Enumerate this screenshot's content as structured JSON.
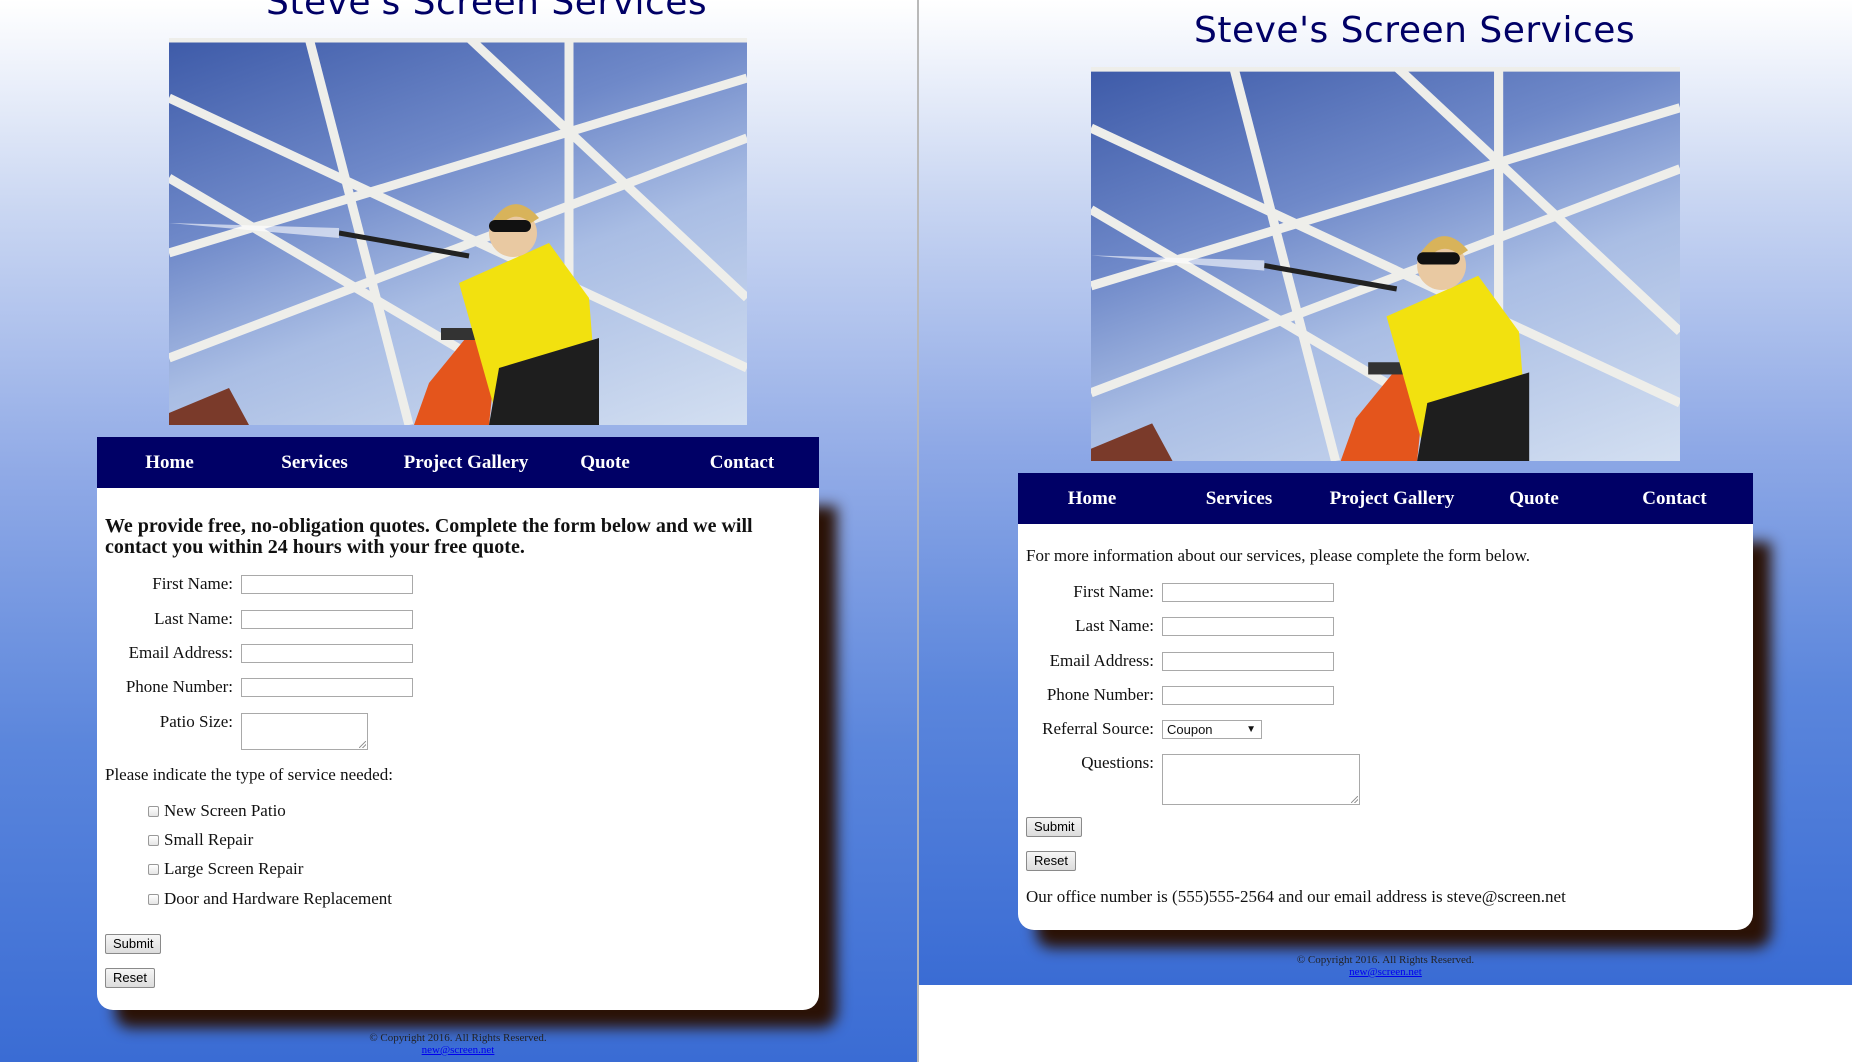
{
  "site_title": "Steve's Screen Services",
  "nav": {
    "items": [
      "Home",
      "Services",
      "Project Gallery",
      "Quote",
      "Contact"
    ]
  },
  "hero": {
    "alt": "Woman in yellow shirt pressure washing a patio screen enclosure from an orange ladder"
  },
  "quote_page": {
    "heading": "We provide free, no-obligation quotes. Complete the form below and we will contact you within 24 hours with your free quote.",
    "fields": [
      {
        "label": "First Name:",
        "value": ""
      },
      {
        "label": "Last Name:",
        "value": ""
      },
      {
        "label": "Email Address:",
        "value": ""
      },
      {
        "label": "Phone Number:",
        "value": ""
      }
    ],
    "patio_label": "Patio Size:",
    "service_prompt": "Please indicate the type of service needed:",
    "services": [
      "New Screen Patio",
      "Small Repair",
      "Large Screen Repair",
      "Door and Hardware Replacement"
    ],
    "submit": "Submit",
    "reset": "Reset"
  },
  "contact_page": {
    "intro": "For more information about our services, please complete the form below.",
    "fields": [
      {
        "label": "First Name:",
        "value": ""
      },
      {
        "label": "Last Name:",
        "value": ""
      },
      {
        "label": "Email Address:",
        "value": ""
      },
      {
        "label": "Phone Number:",
        "value": ""
      }
    ],
    "referral_label": "Referral Source:",
    "referral_selected": "Coupon",
    "questions_label": "Questions:",
    "submit": "Submit",
    "reset": "Reset",
    "office_line": "Our office number is (555)555-2564 and our email address is steve@screen.net"
  },
  "footer": {
    "copyright": "© Copyright 2016. All Rights Reserved.",
    "email": "new@screen.net"
  },
  "colors": {
    "nav_bg": "#000066",
    "title": "#000066",
    "card_shadow": "#2b1206"
  }
}
